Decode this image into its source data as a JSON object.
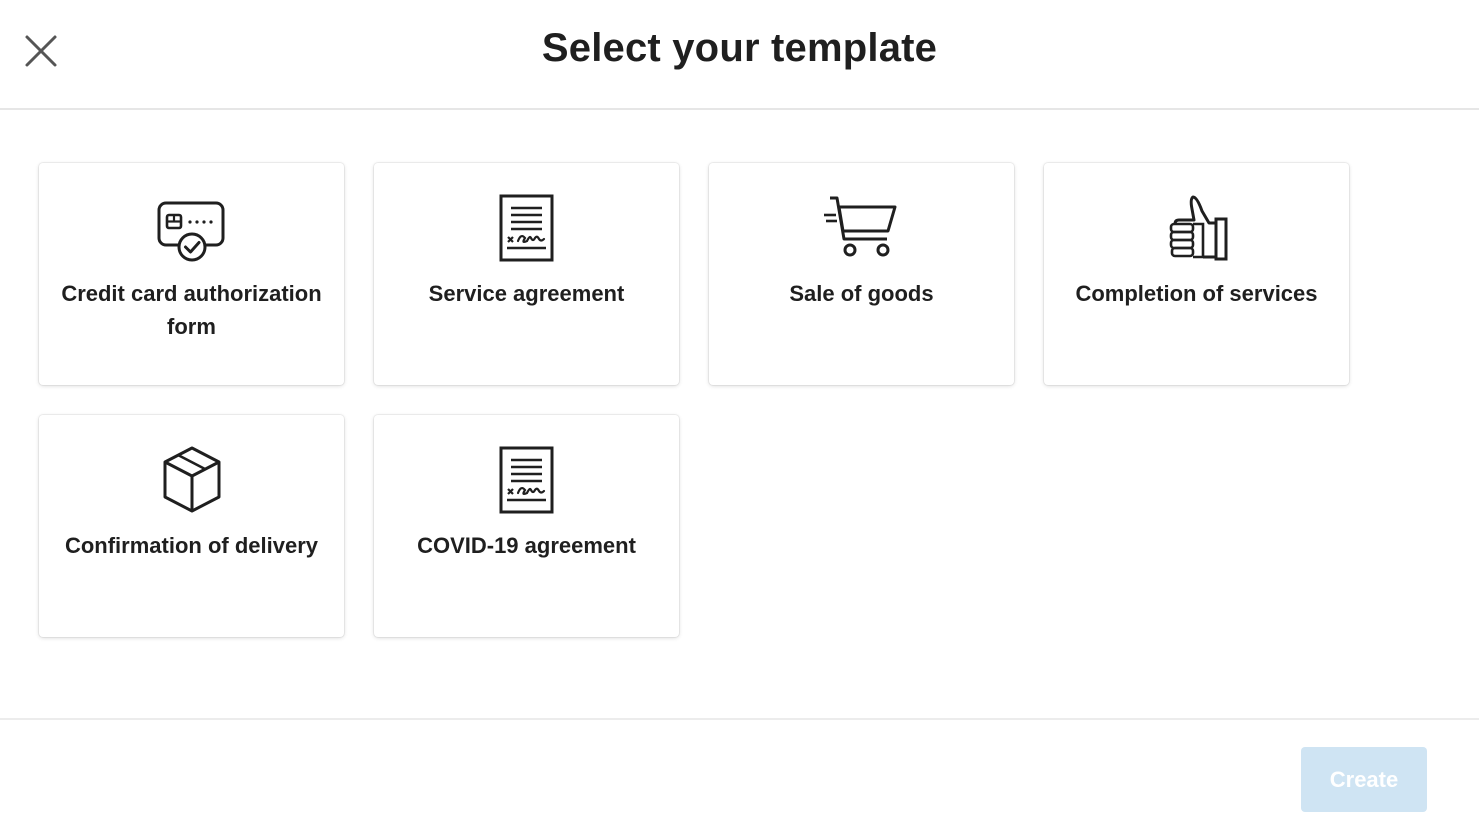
{
  "header": {
    "title": "Select your template",
    "close_icon": "close-icon"
  },
  "templates": [
    {
      "label": "Credit card authorization form",
      "icon": "credit-card-check-icon"
    },
    {
      "label": "Service agreement",
      "icon": "signed-document-icon"
    },
    {
      "label": "Sale of goods",
      "icon": "shopping-cart-icon"
    },
    {
      "label": "Completion of services",
      "icon": "thumbs-up-icon"
    },
    {
      "label": "Confirmation of delivery",
      "icon": "package-box-icon"
    },
    {
      "label": "COVID-19 agreement",
      "icon": "signed-document-icon"
    }
  ],
  "footer": {
    "create_label": "Create",
    "create_enabled": false
  },
  "colors": {
    "create_button_disabled_bg": "#cfe4f3",
    "text": "#1f1f1f",
    "divider": "#e6e6e6"
  }
}
